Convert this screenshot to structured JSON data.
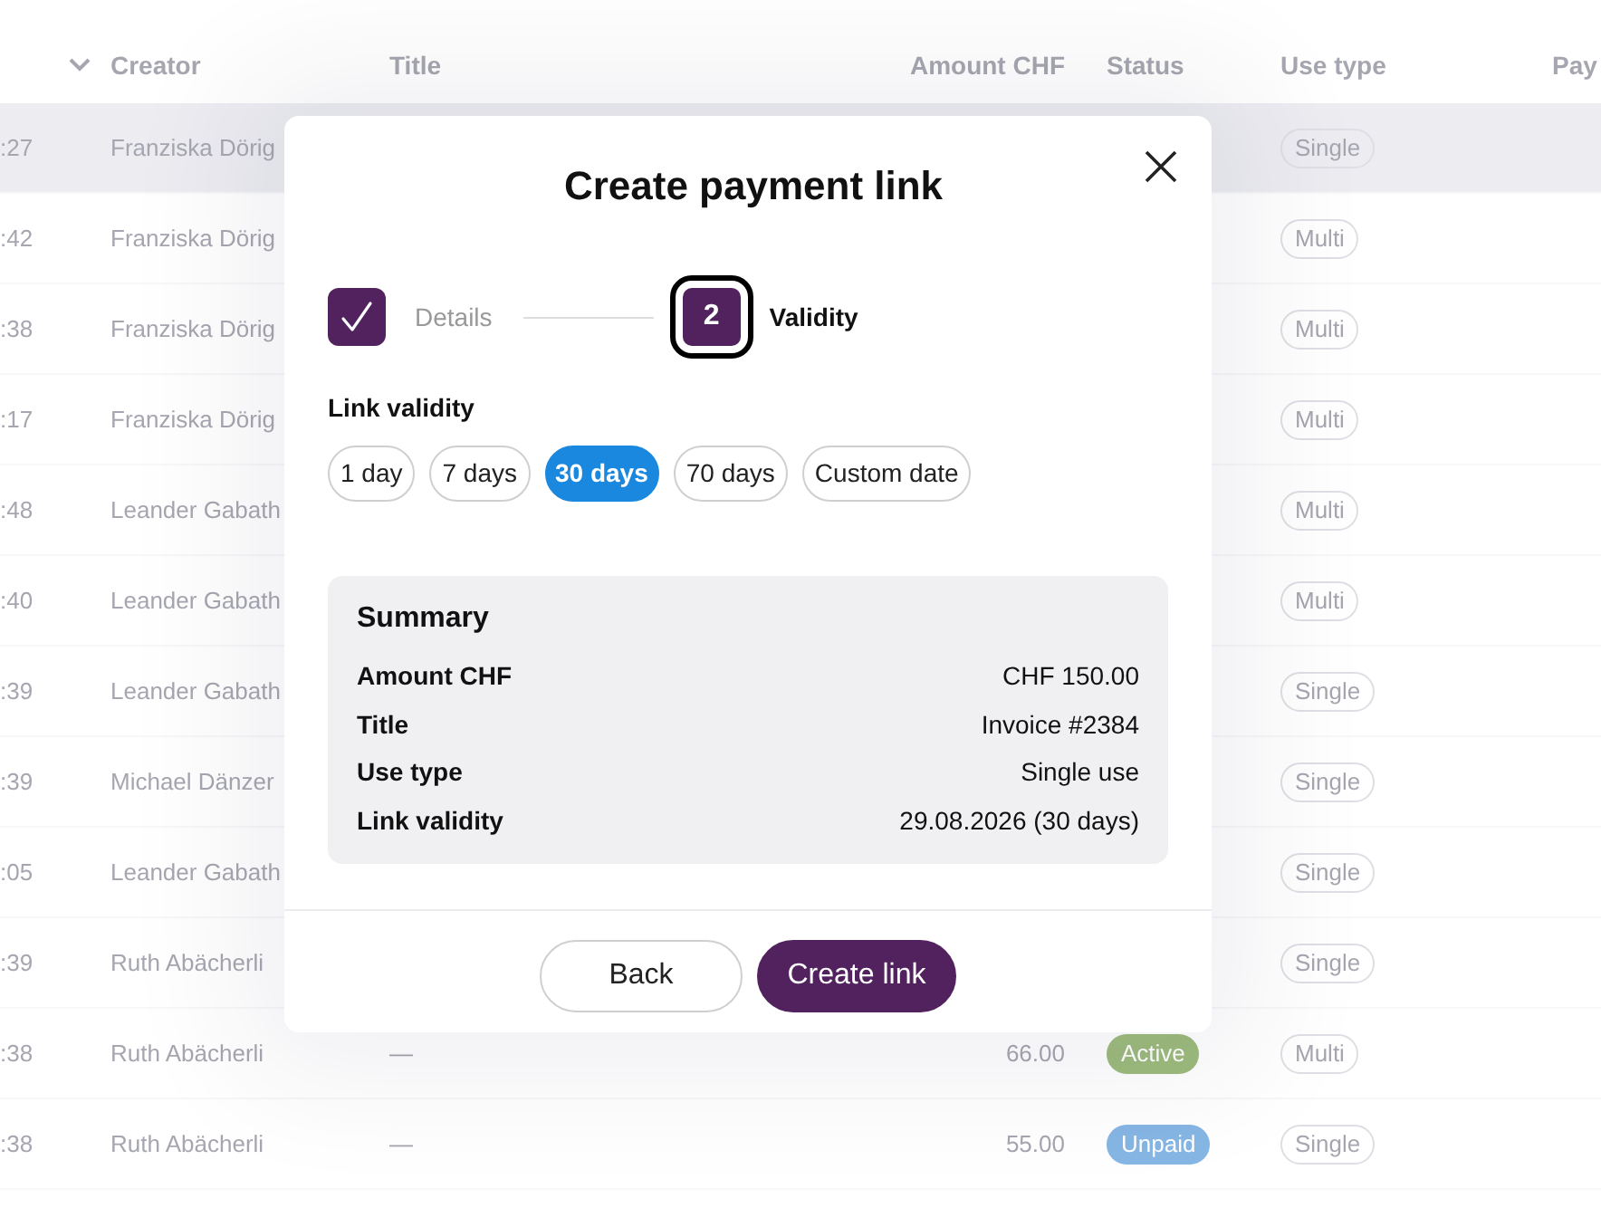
{
  "table": {
    "columns": [
      "Creator",
      "Title",
      "Amount CHF",
      "Status",
      "Use type",
      "Pay"
    ],
    "rows": [
      {
        "column_1": ":27",
        "creator": "Franziska Dörig",
        "use_type": "Single",
        "highlighted": true
      },
      {
        "column_1": ":42",
        "creator": "Franziska Dörig",
        "use_type": "Multi",
        "highlighted": false
      },
      {
        "column_1": ":38",
        "creator": "Franziska Dörig",
        "use_type": "Multi",
        "highlighted": false
      },
      {
        "column_1": ":17",
        "creator": "Franziska Dörig",
        "use_type": "Multi",
        "highlighted": false
      },
      {
        "column_1": ":48",
        "creator": "Leander Gabath",
        "use_type": "Multi",
        "highlighted": false
      },
      {
        "column_1": ":40",
        "creator": "Leander Gabath",
        "use_type": "Multi",
        "highlighted": false
      },
      {
        "column_1": ":39",
        "creator": "Leander Gabath",
        "use_type": "Single",
        "highlighted": false
      },
      {
        "column_1": ":39",
        "creator": "Michael Dänzer",
        "use_type": "Single",
        "highlighted": false
      },
      {
        "column_1": ":05",
        "creator": "Leander Gabath",
        "use_type": "Single",
        "highlighted": false
      },
      {
        "column_1": ":39",
        "creator": "Ruth Abächerli",
        "use_type": "Single",
        "highlighted": false
      },
      {
        "column_1": ":38",
        "creator": "Ruth Abächerli",
        "title": "—",
        "amount": "66.00",
        "status": {
          "label": "Active",
          "color": "#9dbb7c"
        },
        "use_type": "Multi",
        "highlighted": false
      },
      {
        "column_1": ":38",
        "creator": "Ruth Abächerli",
        "title": "—",
        "amount": "55.00",
        "status": {
          "label": "Unpaid",
          "color": "#86b6e4"
        },
        "use_type": "Single",
        "highlighted": false
      }
    ]
  },
  "dialog": {
    "title": "Create payment link",
    "stepper": {
      "steps": [
        {
          "label": "Details",
          "completed": true,
          "selected": false
        },
        {
          "number": "2",
          "label": "Validity",
          "completed": false,
          "selected": true
        }
      ]
    },
    "link_validity": {
      "label": "Link validity",
      "options": [
        {
          "label": "1 day",
          "selected": false
        },
        {
          "label": "7 days",
          "selected": false
        },
        {
          "label": "30 days",
          "selected": true
        },
        {
          "label": "70 days",
          "selected": false
        },
        {
          "label": "Custom date",
          "selected": false
        }
      ]
    },
    "summary": {
      "title": "Summary",
      "rows": [
        {
          "label": "Amount CHF",
          "value": "CHF 150.00"
        },
        {
          "label": "Title",
          "value": "Invoice #2384"
        },
        {
          "label": "Use type",
          "value": "Single use"
        },
        {
          "label": "Link validity",
          "value": "29.08.2026 (30 days)"
        }
      ]
    },
    "buttons": [
      {
        "label": "Back",
        "kind": "secondary"
      },
      {
        "label": "Create link",
        "kind": "primary"
      }
    ]
  }
}
